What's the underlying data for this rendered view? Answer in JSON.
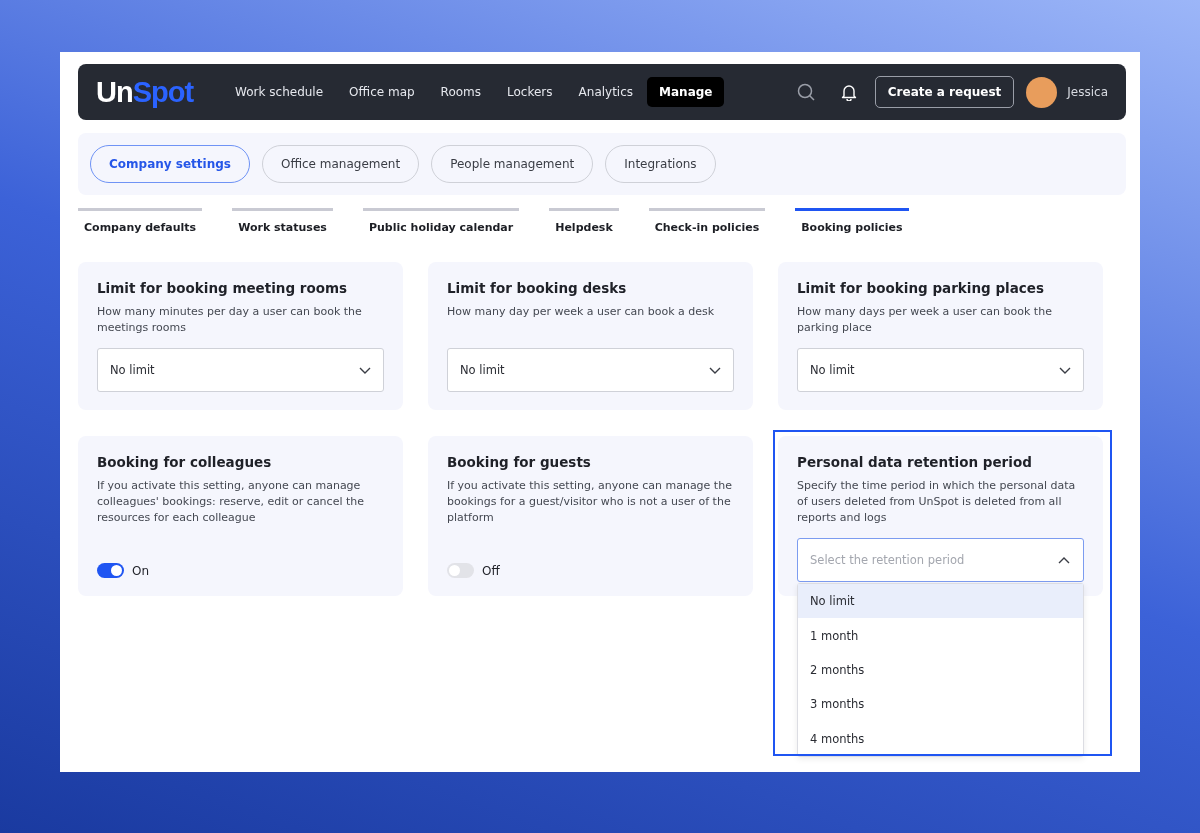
{
  "header": {
    "logo": {
      "first": "Un",
      "second": "Spot"
    },
    "nav": [
      {
        "label": "Work schedule",
        "selected": false
      },
      {
        "label": "Office map",
        "selected": false
      },
      {
        "label": "Rooms",
        "selected": false
      },
      {
        "label": "Lockers",
        "selected": false
      },
      {
        "label": "Analytics",
        "selected": false
      },
      {
        "label": "Manage",
        "selected": true
      }
    ],
    "create_button": "Create a request",
    "user": {
      "name": "Jessica"
    }
  },
  "sections": [
    {
      "label": "Company settings",
      "selected": true
    },
    {
      "label": "Office management",
      "selected": false
    },
    {
      "label": "People management",
      "selected": false
    },
    {
      "label": "Integrations",
      "selected": false
    }
  ],
  "tabs": [
    {
      "label": "Company defaults",
      "selected": false
    },
    {
      "label": "Work statuses",
      "selected": false
    },
    {
      "label": "Public holiday calendar",
      "selected": false
    },
    {
      "label": "Helpdesk",
      "selected": false
    },
    {
      "label": "Check-in policies",
      "selected": false
    },
    {
      "label": "Booking policies",
      "selected": true
    }
  ],
  "cards": [
    {
      "kind": "select",
      "title": "Limit for booking meeting rooms",
      "description": "How many minutes per day a user can book the meetings rooms",
      "value": "No limit"
    },
    {
      "kind": "select",
      "title": "Limit for booking desks",
      "description": "How many day per week a user can book a desk",
      "value": "No limit"
    },
    {
      "kind": "select",
      "title": "Limit for booking parking places",
      "description": "How many days per week a user can book the parking place",
      "value": "No limit"
    },
    {
      "kind": "toggle",
      "title": "Booking for colleagues",
      "description": "If you activate this setting, anyone can manage colleagues' bookings: reserve, edit or cancel the resources for each colleague",
      "on": true,
      "state_label": "On"
    },
    {
      "kind": "toggle",
      "title": "Booking for guests",
      "description": "If you activate this setting, anyone can manage the bookings for a guest/visitor who is not a user of the platform",
      "on": false,
      "state_label": "Off"
    },
    {
      "kind": "dropdown",
      "title": "Personal data retention period",
      "description": "Specify the time period in which the personal data of users deleted from UnSpot is deleted from all reports and logs",
      "placeholder": "Select the retention period",
      "expanded": true,
      "highlighted": true,
      "options": [
        {
          "label": "No limit",
          "selected": true
        },
        {
          "label": "1 month",
          "selected": false
        },
        {
          "label": "2 months",
          "selected": false
        },
        {
          "label": "3 months",
          "selected": false
        },
        {
          "label": "4 months",
          "selected": false
        }
      ]
    }
  ]
}
